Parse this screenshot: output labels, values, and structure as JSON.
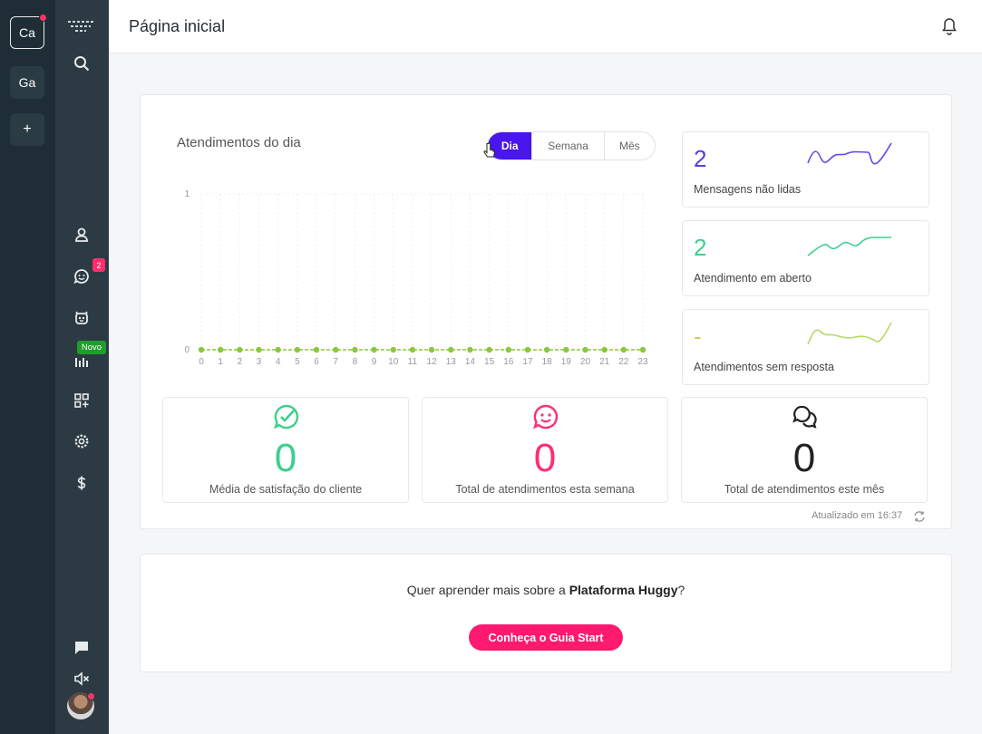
{
  "workspaces": [
    {
      "label": "Ca",
      "active": true,
      "notification": true
    },
    {
      "label": "Ga",
      "active": false,
      "notification": false
    },
    {
      "label": "+",
      "active": false,
      "notification": false
    }
  ],
  "nav": {
    "chat_badge": "2",
    "reports_badge": "Novo",
    "icons": [
      "menu-logo-icon",
      "search-icon",
      "contacts-icon",
      "chat-icon",
      "bot-icon",
      "reports-icon",
      "apps-icon",
      "settings-icon",
      "billing-icon",
      "feedback-icon",
      "mute-icon"
    ]
  },
  "header": {
    "title": "Página inicial"
  },
  "chart": {
    "title": "Atendimentos do dia",
    "tabs": [
      "Dia",
      "Semana",
      "Mês"
    ],
    "active_tab": "Dia"
  },
  "chart_data": {
    "type": "line",
    "title": "Atendimentos do dia",
    "x": [
      "0",
      "1",
      "2",
      "3",
      "4",
      "5",
      "6",
      "7",
      "8",
      "9",
      "10",
      "11",
      "12",
      "13",
      "14",
      "15",
      "16",
      "17",
      "18",
      "19",
      "20",
      "21",
      "22",
      "23"
    ],
    "series": [
      {
        "values": [
          0,
          0,
          0,
          0,
          0,
          0,
          0,
          0,
          0,
          0,
          0,
          0,
          0,
          0,
          0,
          0,
          0,
          0,
          0,
          0,
          0,
          0,
          0,
          0
        ]
      }
    ],
    "ylim": [
      0,
      1
    ],
    "y_ticks": [
      "0",
      "1"
    ],
    "grid": true,
    "color": "#8cc63f"
  },
  "stats": [
    {
      "value": "2",
      "label": "Mensagens não lidas",
      "color": "#5a3ee0"
    },
    {
      "value": "2",
      "label": "Atendimento em aberto",
      "color": "#3ecf8e"
    },
    {
      "value": "-",
      "label": "Atendimentos sem resposta",
      "color": "#b5d86a"
    }
  ],
  "kpis": [
    {
      "value": "0",
      "label": "Média de satisfação do cliente",
      "color": "#3ecf8e",
      "icon": "check-chat-icon"
    },
    {
      "value": "0",
      "label": "Total de atendimentos esta semana",
      "color": "#ff2d7a",
      "icon": "smile-chat-icon"
    },
    {
      "value": "0",
      "label": "Total de atendimentos este mês",
      "color": "#222222",
      "icon": "chats-icon"
    }
  ],
  "updated": "Atualizado em 16:37",
  "learn": {
    "text_prefix": "Quer aprender mais sobre a ",
    "text_bold": "Plataforma Huggy",
    "text_suffix": "?",
    "button": "Conheça o Guia Start"
  }
}
